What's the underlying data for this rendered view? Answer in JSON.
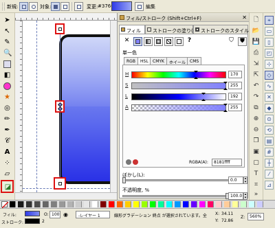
{
  "topbar": {
    "new_label": "新規:",
    "target_label": "対象:",
    "change_label": "変更:",
    "hex_text": "#3766",
    "edit_label": "編集"
  },
  "canvas": {
    "gradient_top": "#a6b4f2",
    "gradient_bottom": "#2a31e6",
    "outline": "#111111"
  },
  "dock": {
    "title": "フィル/ストローク (Shift+Ctrl+F)",
    "close_glyph": "✕",
    "tabs": [
      {
        "label": "フィル"
      },
      {
        "label": "ストロークの塗り(P)"
      },
      {
        "label": "ストロークのスタイル(Y)"
      }
    ],
    "paint_types": [
      "✕",
      "",
      "",
      "",
      "",
      "?"
    ],
    "section_title": "単一色",
    "color_modes": [
      "RGB",
      "HSL",
      "CMYK",
      "ホイール",
      "CMS"
    ],
    "sliders": [
      {
        "label": "H",
        "value": "170"
      },
      {
        "label": "S",
        "value": "255"
      },
      {
        "label": "L",
        "value": "192"
      },
      {
        "label": "A",
        "value": "255"
      }
    ],
    "rgba_label": "RGBA(A):",
    "rgba_value": "8181ffff",
    "blur_label": "ぼかし(L):",
    "blur_value": "0.0",
    "opacity_label": "不透明度, %",
    "opacity_value": "100.0"
  },
  "status": {
    "fill_label": "フィル:",
    "stroke_label": "ストローク:",
    "stroke_width": "2",
    "opacity_label": "O:",
    "opacity_value": "100",
    "layer_label": "-レイヤー 1",
    "message": "線形グラデーション 終点 が選択されています。全",
    "x_label": "X:",
    "x_value": "34.11",
    "y_label": "Y:",
    "y_value": "72.86",
    "zoom_label": "Z:",
    "zoom_value": "560%"
  }
}
